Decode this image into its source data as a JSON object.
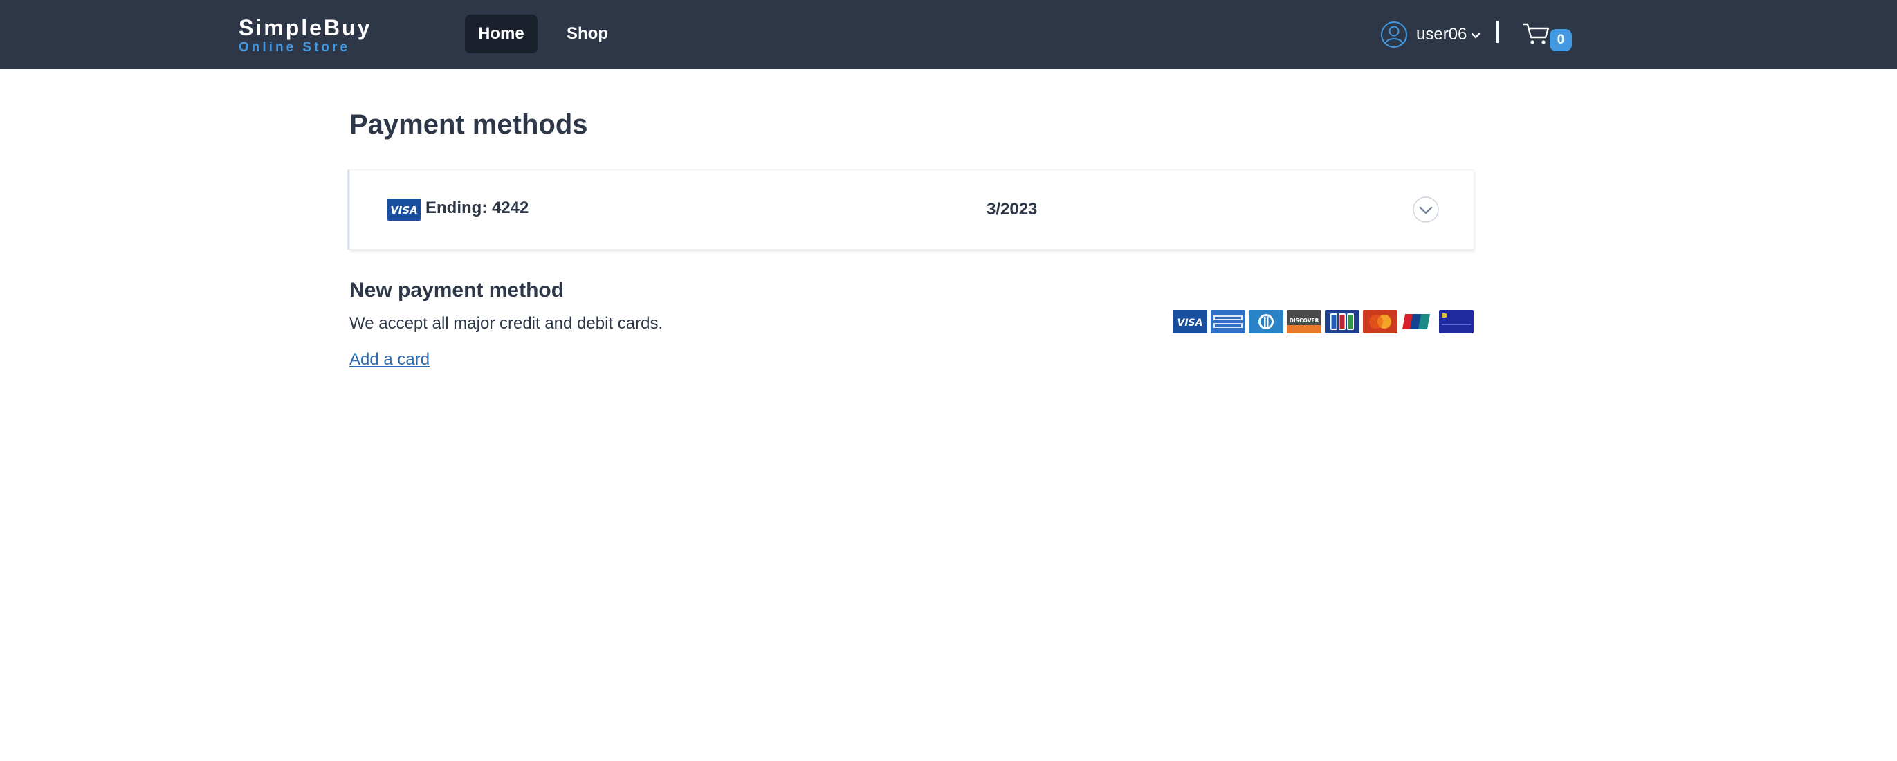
{
  "header": {
    "brand_name": "SimpleBuy",
    "brand_tagline": "Online Store",
    "nav": [
      {
        "label": "Home",
        "active": true
      },
      {
        "label": "Shop",
        "active": false
      }
    ],
    "user": {
      "name": "user06",
      "icon": "user-circle-icon"
    },
    "cart": {
      "count": "0",
      "icon": "cart-icon"
    }
  },
  "main": {
    "title": "Payment methods",
    "saved_cards": [
      {
        "brand": "VISA",
        "ending_label": "Ending: 4242",
        "expiry": "3/2023"
      }
    ],
    "new_method": {
      "title": "New payment method",
      "description": "We accept all major credit and debit cards.",
      "add_card_label": "Add a card",
      "accepted_brands": [
        "visa",
        "american-express",
        "diners-club",
        "discover",
        "jcb",
        "mastercard",
        "unionpay",
        "generic-card"
      ]
    }
  },
  "colors": {
    "navbar_bg": "#2d3748",
    "nav_active_bg": "#1a202c",
    "accent": "#4299e1",
    "link": "#2b6cb0",
    "text": "#2d3748"
  }
}
